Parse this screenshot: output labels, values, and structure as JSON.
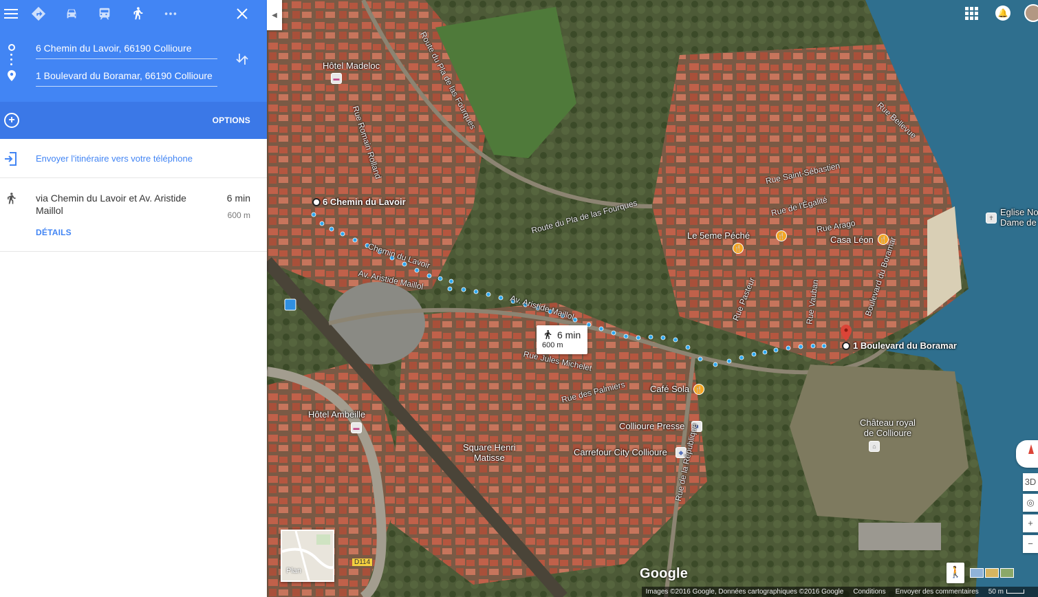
{
  "panel": {
    "origin": "6 Chemin du Lavoir, 66190 Collioure",
    "destination": "1 Boulevard du Boramar, 66190 Collioure",
    "options_label": "OPTIONS",
    "send_link": "Envoyer l'itinéraire vers votre téléphone",
    "route": {
      "via": "via Chemin du Lavoir et Av. Aristide Maillol",
      "time": "6 min",
      "distance": "600 m",
      "details_label": "DÉTAILS"
    }
  },
  "map": {
    "start_label": "6 Chemin du Lavoir",
    "end_label": "1 Boulevard du Boramar",
    "route_box": {
      "time": "6 min",
      "distance": "600 m"
    },
    "places": {
      "hotel_madeloc": "Hôtel Madeloc",
      "hotel_ambeille": "Hôtel Ambeille",
      "le_5eme_peche": "Le 5eme Péché",
      "casa_leon": "Casa Léon",
      "cafe_sola": "Café Sola",
      "collioure_presse": "Collioure Presse",
      "carrefour": "Carrefour City Collioure",
      "square_henri_1": "Square Henri",
      "square_henri_2": "Matisse",
      "chateau_1": "Château royal",
      "chateau_2": "de Collioure",
      "eglise_1": "Eglise No",
      "eglise_2": "Dame de"
    },
    "streets": {
      "route_pla_1": "Route du Pla de las Fourques",
      "route_pla_2": "Route du Pla de las Fourques",
      "rue_romain": "Rue Romain Rolland",
      "chemin_lavoir": "Chemin du Lavoir",
      "av_maillol_1": "Av. Aristide Maillol",
      "av_maillol_2": "Av. Aristide Maillol",
      "rue_jules": "Rue Jules Michelet",
      "rue_palmiers": "Rue des Palmiers",
      "rue_pasteur": "Rue Pasteur",
      "rue_vauban": "Rue Vauban",
      "boulevard": "Boulevard du Boramar",
      "rue_arago": "Rue Arago",
      "rue_egalite": "Rue de l'Égalité",
      "rue_sebastien": "Rue Saint-Sébastien",
      "rue_bellevue": "Rue Bellevue",
      "rue_republique": "Rue de la République",
      "d114": "D114"
    },
    "plan_label": "Plan",
    "google": "Google",
    "view_3d": "3D",
    "zoom_in": "+",
    "zoom_out": "−",
    "footer": {
      "attribution": "Images ©2016 Google, Données cartographiques ©2016 Google",
      "conditions": "Conditions",
      "feedback": "Envoyer des commentaires",
      "scale": "50 m"
    }
  },
  "colors": {
    "header_blue": "#4285f4",
    "options_blue": "#3b78e7",
    "route_dots": "#2fa8f0",
    "destination_pin": "#db4437"
  }
}
